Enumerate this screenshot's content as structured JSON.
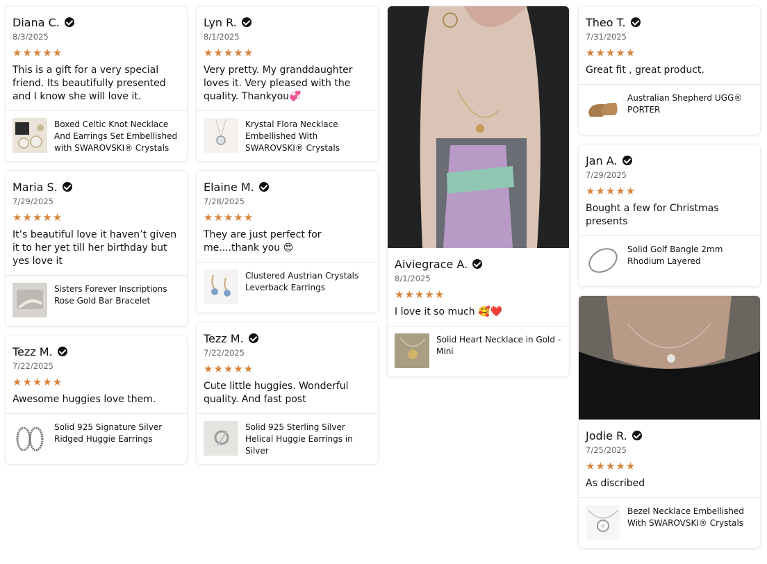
{
  "colors": {
    "star": "#d8843c",
    "text": "#111111",
    "date": "#666666"
  },
  "columns": [
    [
      {
        "name": "Diana C.",
        "date": "8/3/2025",
        "stars": "★★★★★",
        "text": "This is a gift for a very special friend.  Its beautifully presented and I know she will love it.",
        "product": "Boxed Celtic Knot Necklace And Earrings Set Embellished with SWAROVSKI® Crystals"
      },
      {
        "name": "Maria S.",
        "date": "7/29/2025",
        "stars": "★★★★★",
        "text": "It’s beautiful love it haven’t given it to her yet till her birthday but yes love it",
        "product": "Sisters Forever Inscriptions Rose Gold Bar Bracelet"
      },
      {
        "name": "Tezz M.",
        "date": "7/22/2025",
        "stars": "★★★★★",
        "text": "Awesome huggies love them.",
        "product": "Solid 925 Signature Silver Ridged Huggie Earrings"
      }
    ],
    [
      {
        "name": "Lyn R.",
        "date": "8/1/2025",
        "stars": "★★★★★",
        "text": "Very pretty. My granddaughter loves it. Very pleased with the quality. Thankyou💞",
        "product": "Krystal Flora Necklace Embellished With SWAROVSKI® Crystals"
      },
      {
        "name": "Elaine M.",
        "date": "7/28/2025",
        "stars": "★★★★★",
        "text": "They are just perfect for me....thank you 😍",
        "product": "Clustered Austrian Crystals Leverback Earrings"
      },
      {
        "name": "Tezz M.",
        "date": "7/22/2025",
        "stars": "★★★★★",
        "text": "Cute little huggies. Wonderful quality. And fast post",
        "product": "Solid 925 Sterling Silver Helical Huggie Earrings in Silver"
      }
    ],
    [
      {
        "name": "Aiviegrace A.",
        "date": "8/1/2025",
        "stars": "★★★★★",
        "text": "I love it so much 🥰❤️",
        "product": "Solid Heart Necklace in Gold - Mini",
        "photo": "customer-photo-heart-necklace"
      }
    ],
    [
      {
        "name": "Theo T.",
        "date": "7/31/2025",
        "stars": "★★★★★",
        "text": "Great fit , great product.",
        "product": "Australian Shepherd UGG® PORTER"
      },
      {
        "name": "Jan A.",
        "date": "7/29/2025",
        "stars": "★★★★★",
        "text": "Bought a few for Christmas presents",
        "product": "Solid Golf Bangle 2mm Rhodium Layered"
      },
      {
        "name": "Jodie R.",
        "date": "7/25/2025",
        "stars": "★★★★★",
        "text": "As discribed",
        "product": "Bezel Necklace Embellished With SWAROVSKI® Crystals",
        "photo": "customer-photo-bezel-necklace"
      }
    ]
  ]
}
